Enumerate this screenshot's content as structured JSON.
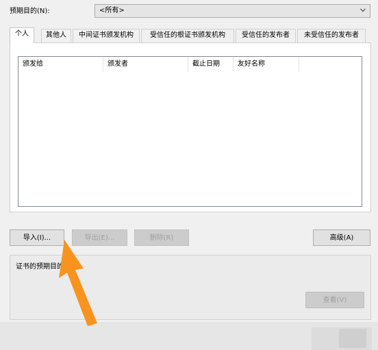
{
  "purpose": {
    "label": "预期目的(N):",
    "value": "<所有>"
  },
  "tabs": [
    {
      "label": "个人",
      "active": true
    },
    {
      "label": "其他人",
      "active": false
    },
    {
      "label": "中间证书颁发机构",
      "active": false
    },
    {
      "label": "受信任的根证书颁发机构",
      "active": false
    },
    {
      "label": "受信任的发布者",
      "active": false
    },
    {
      "label": "未受信任的发布者",
      "active": false
    }
  ],
  "list": {
    "columns": [
      "颁发给",
      "颁发者",
      "截止日期",
      "友好名称"
    ]
  },
  "buttons": {
    "import": "导入(I)...",
    "export": "导出(E)...",
    "delete": "删除(R)",
    "advanced": "高级(A)"
  },
  "group": {
    "title": "证书的预期目的",
    "view_button": "查看(V)"
  },
  "colors": {
    "window_bg": "#f0f0f0",
    "panel_bg": "#ffffff",
    "button_bg": "#e1e1e1",
    "disabled_text": "#a0a0a0",
    "arrow": "#f7931e"
  }
}
